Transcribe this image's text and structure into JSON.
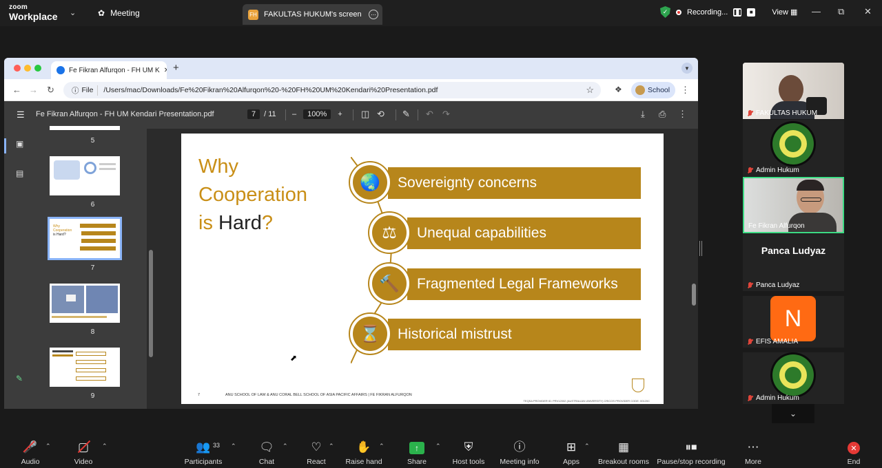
{
  "zoom": {
    "logo_line1": "zoom",
    "logo_line2": "Workplace",
    "meeting_label": "Meeting",
    "screen_tab": "FAKULTAS HUKUM's screen",
    "screen_tab_badge": "FH",
    "recording_label": "Recording...",
    "view_label": "View"
  },
  "browser": {
    "tab_title": "Fe Fikran Alfurqon - FH UM K",
    "file_chip": "File",
    "url": "/Users/mac/Downloads/Fe%20Fikran%20Alfurqon%20-%20FH%20UM%20Kendari%20Presentation.pdf",
    "profile_label": "School"
  },
  "pdf": {
    "title": "Fe Fikran Alfurqon - FH UM Kendari Presentation.pdf",
    "current_page": "7",
    "total_pages": "/ 11",
    "zoom": "100%",
    "thumb_numbers": [
      "5",
      "6",
      "7",
      "8",
      "9"
    ]
  },
  "slide": {
    "title_line1": "Why",
    "title_line2": "Cooperation",
    "title_line3_a": "is ",
    "title_line3_b": "Hard",
    "title_line3_c": "?",
    "items": [
      "Sovereignty concerns",
      "Unequal capabilities",
      "Fragmented Legal Frameworks",
      "Historical mistrust"
    ],
    "footer_page": "7",
    "footer_affiliation": "ANU SCHOOL OF LAW & ANU CORAL BELL SCHOOL OF ASIA PACIFIC AFFAIRS  |  FE FIKRAN ALFURQON",
    "footer_right": "TEQSA PROVIDER ID: PRV12002 (AUSTRALIAN UNIVERSITY) CRICOS PROVIDER CODE: 00120C",
    "accent": "#b7861b"
  },
  "participants": [
    {
      "name": "FAKULTAS HUKUM",
      "kind": "video"
    },
    {
      "name": "Admin  Hukum",
      "kind": "logo"
    },
    {
      "name": "Fe Fikran Alfurqon",
      "kind": "video-active"
    },
    {
      "name": "Panca Ludyaz",
      "display": "Panca Ludyaz",
      "kind": "text"
    },
    {
      "name": "EFIS AMALIA",
      "initial": "N",
      "kind": "letter"
    },
    {
      "name": "Admin  Hukum",
      "kind": "logo"
    }
  ],
  "toolbar": {
    "audio": "Audio",
    "video": "Video",
    "participants": "Participants",
    "participants_count": "33",
    "chat": "Chat",
    "react": "React",
    "raise_hand": "Raise hand",
    "share": "Share",
    "host_tools": "Host tools",
    "meeting_info": "Meeting info",
    "apps": "Apps",
    "breakout_rooms": "Breakout rooms",
    "pause_stop_recording": "Pause/stop recording",
    "more": "More",
    "end": "End"
  }
}
